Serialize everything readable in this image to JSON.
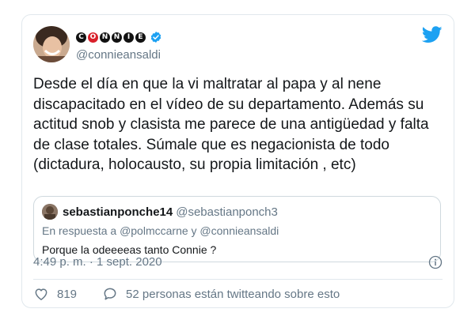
{
  "author": {
    "logo_letters": [
      "C",
      "O",
      "N",
      "N",
      "I",
      "E"
    ],
    "handle": "@connieansaldi",
    "verified": true
  },
  "tweet": {
    "text": "Desde el día en que la vi maltratar al papa y al nene discapacitado en el vídeo de su departamento. Además su actitud snob y clasista me parece de una antigüedad y falta de clase totales. Súmale que es negacionista de todo (dictadura, holocausto, su propia limitación , etc)",
    "timestamp": "4:49 p. m. · 1 sept. 2020"
  },
  "quoted": {
    "name": "sebastianponche14",
    "handle": "@sebastianponch3",
    "reply_prefix": "En respuesta a",
    "reply_mention_1": "@polmccarne",
    "reply_joiner": "y",
    "reply_mention_2": "@connieansaldi",
    "text": "Porque la odeeeeas tanto Connie ?"
  },
  "actions": {
    "likes": "819",
    "conversation": "52 personas están twitteando sobre esto"
  },
  "colors": {
    "twitter_blue": "#1da1f2",
    "secondary_text": "#657786",
    "logo_red": "#d9202a"
  }
}
